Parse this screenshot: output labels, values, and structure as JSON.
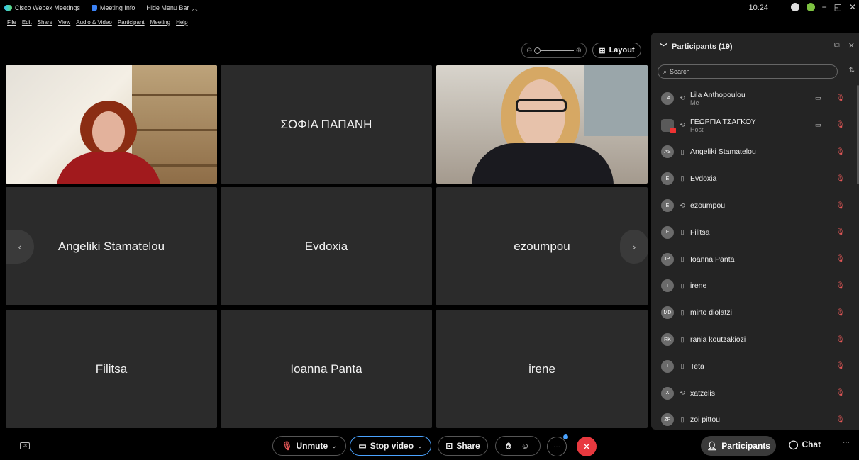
{
  "titlebar": {
    "app_name": "Cisco Webex Meetings",
    "meeting_info": "Meeting Info",
    "hide_menu": "Hide Menu Bar",
    "time": "10:24",
    "min": "−",
    "max": "◱",
    "close": "✕"
  },
  "menu": [
    "File",
    "Edit",
    "Share",
    "View",
    "Audio & Video",
    "Participant",
    "Meeting",
    "Help"
  ],
  "stage": {
    "layout_label": "Layout",
    "tiles": [
      {
        "name": "ΣΟΦΙΑ ΠΑΠΑΝΗ"
      },
      {
        "name": "Angeliki Stamatelou"
      },
      {
        "name": "Evdoxia"
      },
      {
        "name": "ezoumpou"
      },
      {
        "name": "Filitsa"
      },
      {
        "name": "Ioanna Panta"
      },
      {
        "name": "irene"
      }
    ]
  },
  "panel": {
    "title": "Participants (19)",
    "search_placeholder": "Search",
    "participants": [
      {
        "initials": "LA",
        "name": "Lila Anthopoulou",
        "role": "Me",
        "device": "headset",
        "camera": true
      },
      {
        "initials": "",
        "name": "ΓΕΩΡΓΙΑ ΤΣΑΓΚΟΥ",
        "role": "Host",
        "device": "headset",
        "camera": true
      },
      {
        "initials": "AS",
        "name": "Angeliki Stamatelou",
        "role": "",
        "device": "phone",
        "camera": false
      },
      {
        "initials": "E",
        "name": "Evdoxia",
        "role": "",
        "device": "phone",
        "camera": false
      },
      {
        "initials": "E",
        "name": "ezoumpou",
        "role": "",
        "device": "headset",
        "camera": false
      },
      {
        "initials": "F",
        "name": "Filitsa",
        "role": "",
        "device": "phone",
        "camera": false
      },
      {
        "initials": "IP",
        "name": "Ioanna Panta",
        "role": "",
        "device": "phone",
        "camera": false
      },
      {
        "initials": "I",
        "name": "irene",
        "role": "",
        "device": "phone",
        "camera": false
      },
      {
        "initials": "MD",
        "name": "mirto diolatzi",
        "role": "",
        "device": "phone",
        "camera": false
      },
      {
        "initials": "RK",
        "name": "rania koutzakiozi",
        "role": "",
        "device": "phone",
        "camera": false
      },
      {
        "initials": "T",
        "name": "Teta",
        "role": "",
        "device": "phone",
        "camera": false
      },
      {
        "initials": "X",
        "name": "xatzelis",
        "role": "",
        "device": "headset",
        "camera": false
      },
      {
        "initials": "ZP",
        "name": "zoi pittou",
        "role": "",
        "device": "phone",
        "camera": false
      }
    ]
  },
  "controls": {
    "unmute": "Unmute",
    "stop_video": "Stop video",
    "share": "Share",
    "participants": "Participants",
    "chat": "Chat"
  },
  "colors": {
    "end_call": "#e8393f",
    "muted": "#e35757",
    "accent": "#4aa3ff",
    "panel_bg": "#242424",
    "tile_bg": "#2b2b2b"
  }
}
